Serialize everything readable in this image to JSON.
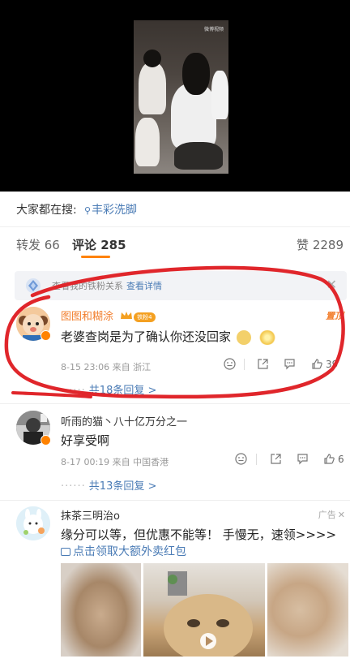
{
  "video": {
    "watermark": "微博视频"
  },
  "search": {
    "label": "大家都在搜:",
    "keyword": "丰彩洗脚"
  },
  "tabs": {
    "repost": "转发 66",
    "comments": "评论 285",
    "likes": "赞 2289"
  },
  "notice": {
    "text": "查看我的铁粉关系",
    "link": "查看详情"
  },
  "comments": [
    {
      "user": "图图和糊涂",
      "badge": "铁粉4",
      "tag": "置顶",
      "text": "老婆查岗是为了确认你还没回家",
      "meta": "8-15 23:06 来自 浙江",
      "likes": "39",
      "replies": "共18条回复 >"
    },
    {
      "user": "听雨的猫丶八十亿万分之一",
      "text": "好享受啊",
      "meta": "8-17 00:19 来自 中国香港",
      "likes": "6",
      "replies": "共13条回复 >"
    },
    {
      "user": "抹茶三明治o",
      "ad_label": "广告",
      "text": "缘分可以等，但优惠不能等！ 手慢无，速领>>>>",
      "promo": "点击领取大额外卖红包"
    }
  ],
  "colors": {
    "accent": "#ff8200",
    "link": "#4a7bb5",
    "annotation": "#e0262b"
  }
}
